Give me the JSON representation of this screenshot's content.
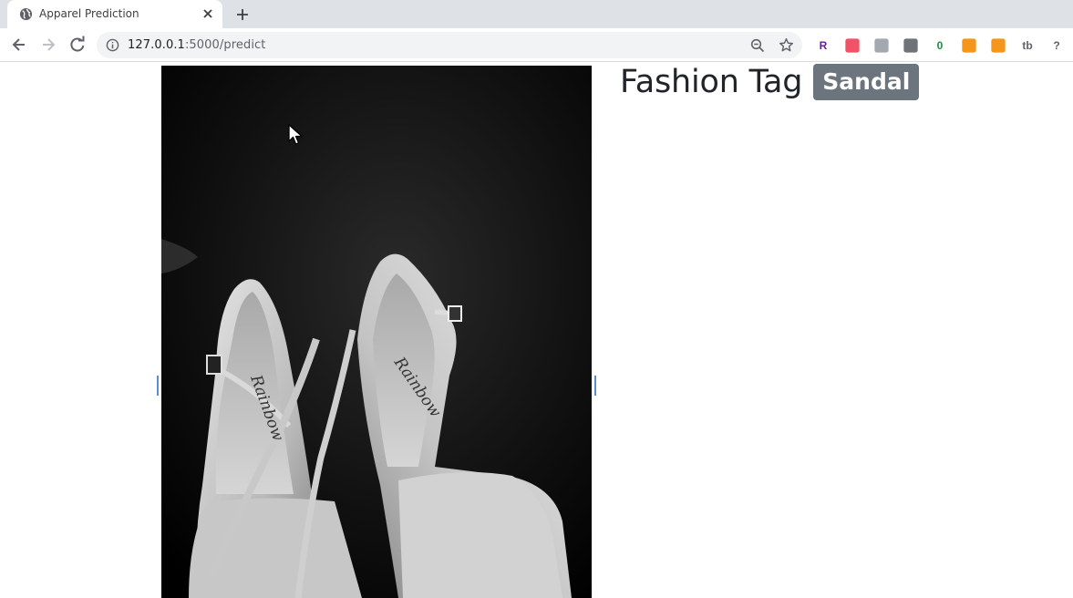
{
  "browser": {
    "tab_title": "Apparel Prediction",
    "url_host": "127.0.0.1",
    "url_rest": ":5000/predict",
    "extensions": [
      {
        "name": "r-extension-icon",
        "glyph": "R",
        "color": "#6a1b9a"
      },
      {
        "name": "pocket-extension-icon",
        "glyph": "",
        "color": "#ef3f56"
      },
      {
        "name": "frame-extension-icon",
        "glyph": "",
        "color": "#9aa0a6"
      },
      {
        "name": "dark-circle-extension-icon",
        "glyph": "",
        "color": "#5f6368"
      },
      {
        "name": "shield-check-extension-icon",
        "glyph": "0",
        "color": "#1e8e3e"
      },
      {
        "name": "bag-extension-icon",
        "glyph": "",
        "color": "#f28b00"
      },
      {
        "name": "key-extension-icon",
        "glyph": "",
        "color": "#f28b00"
      },
      {
        "name": "tb-extension-icon",
        "glyph": "tb",
        "color": "#5f6368"
      },
      {
        "name": "help-extension-icon",
        "glyph": "?",
        "color": "#5f6368"
      }
    ]
  },
  "page": {
    "heading": "Fashion Tag",
    "prediction_label": "Sandal",
    "colors": {
      "badge": "#6c757d",
      "heading": "#212529"
    }
  }
}
